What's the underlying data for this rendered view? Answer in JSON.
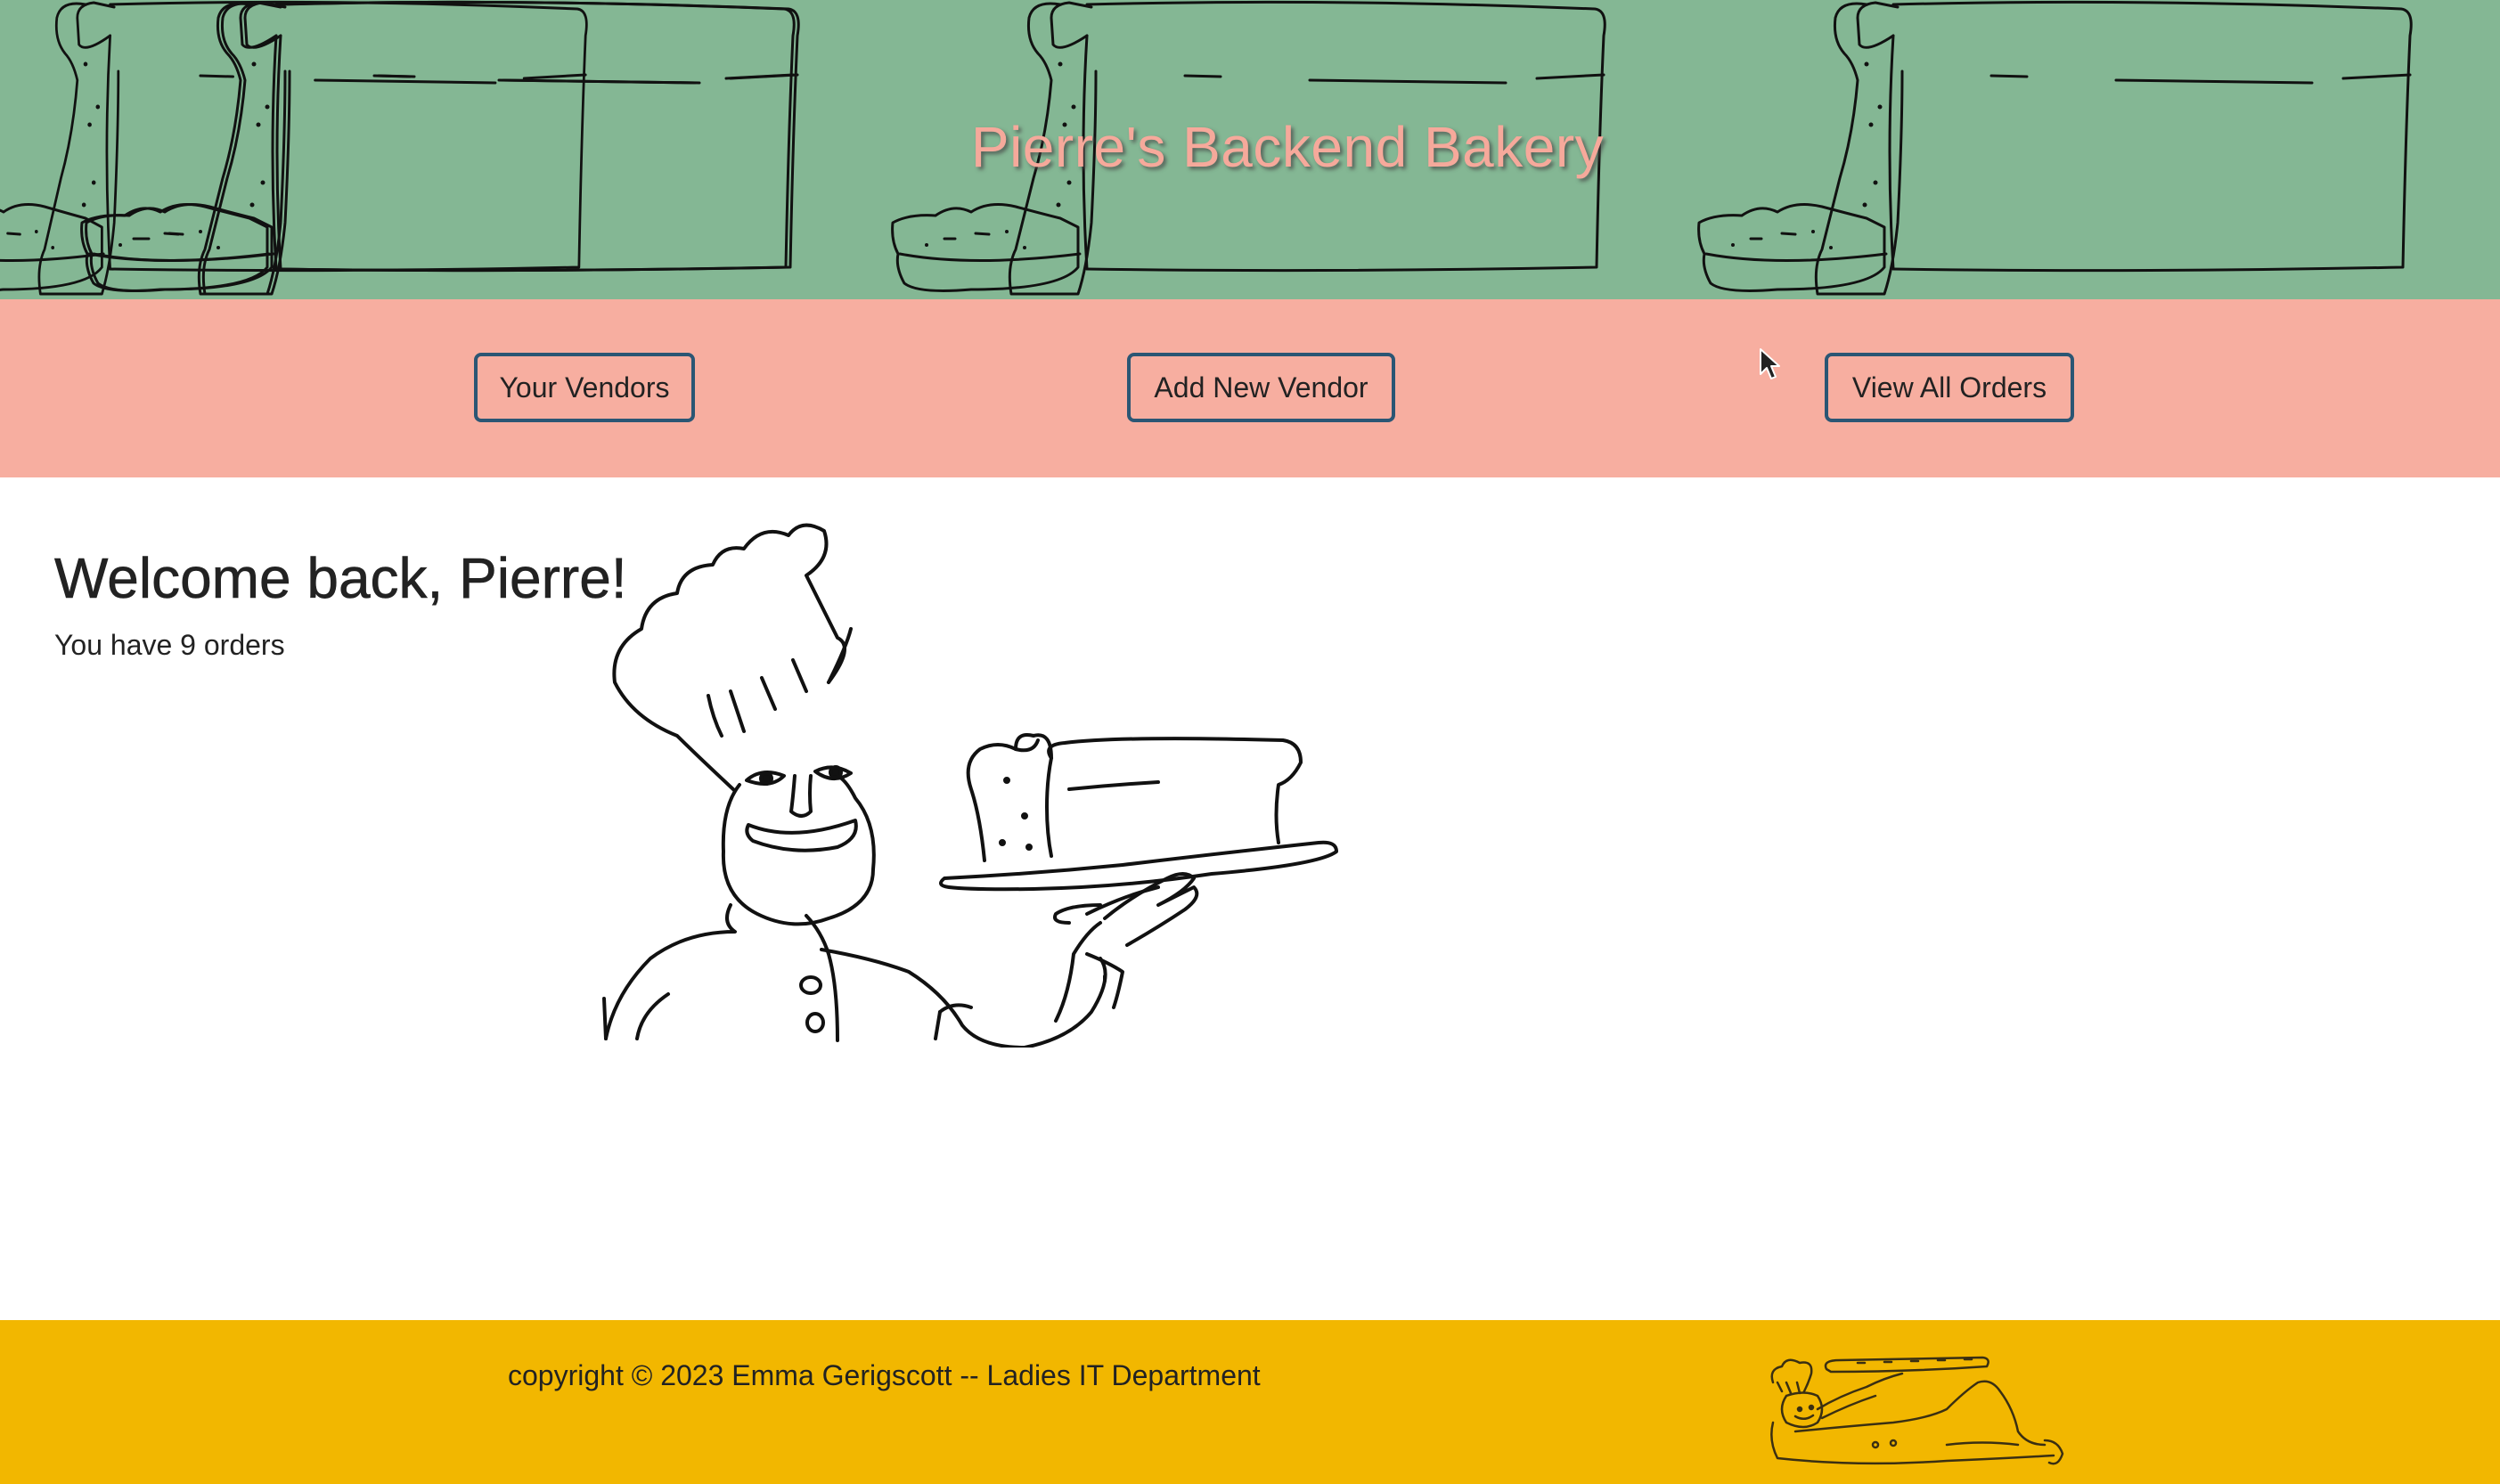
{
  "header": {
    "title": "Pierre's Backend Bakery"
  },
  "nav": {
    "items": [
      {
        "label": "Your Vendors"
      },
      {
        "label": "Add New Vendor"
      },
      {
        "label": "View All Orders"
      }
    ]
  },
  "main": {
    "welcome": "Welcome back, Pierre!",
    "orders_summary": "You have 9 orders"
  },
  "footer": {
    "copyright": "copyright © 2023 Emma Gerigscott -- Ladies IT Department"
  },
  "colors": {
    "header_bg": "#84b794",
    "title": "#f6a99b",
    "nav_bg": "#f7aea0",
    "button_border": "#2b5674",
    "footer_bg": "#f2b700"
  },
  "icons": {
    "header_pattern": "bread-loaf-pattern",
    "main_illustration": "chef-holding-bread",
    "footer_illustration": "reclining-chef-with-baguette",
    "cursor": "mouse-pointer-icon"
  }
}
